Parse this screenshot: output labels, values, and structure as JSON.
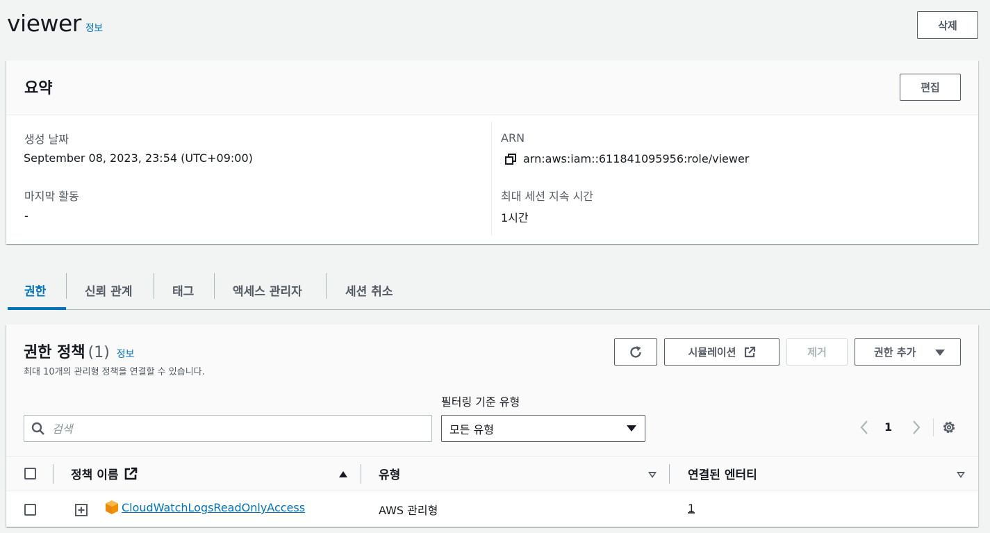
{
  "page": {
    "title": "viewer",
    "info_label": "정보",
    "delete_label": "삭제"
  },
  "summary": {
    "title": "요약",
    "edit_label": "편집",
    "created_label": "생성 날짜",
    "created_value": "September 08, 2023, 23:54 (UTC+09:00)",
    "last_activity_label": "마지막 활동",
    "last_activity_value": "-",
    "arn_label": "ARN",
    "arn_value": "arn:aws:iam::611841095956:role/viewer",
    "max_session_label": "최대 세션 지속 시간",
    "max_session_value": "1시간"
  },
  "tabs": [
    {
      "label": "권한",
      "active": true
    },
    {
      "label": "신뢰 관계"
    },
    {
      "label": "태그"
    },
    {
      "label": "액세스 관리자"
    },
    {
      "label": "세션 취소"
    }
  ],
  "permissions": {
    "title": "권한 정책",
    "count": "(1)",
    "info_label": "정보",
    "description": "최대 10개의 관리형 정책을 연결할 수 있습니다.",
    "simulation_label": "시뮬레이션",
    "remove_label": "제거",
    "add_label": "권한 추가",
    "filter_label": "필터링 기준 유형",
    "search_placeholder": "검색",
    "filter_value": "모든 유형",
    "page_number": "1",
    "columns": {
      "name": "정책 이름",
      "type": "유형",
      "entities": "연결된 엔터티"
    },
    "rows": [
      {
        "name": "CloudWatchLogsReadOnlyAccess",
        "type": "AWS 관리형",
        "entities": "1"
      }
    ]
  },
  "colors": {
    "accent": "#0073bb",
    "text": "#16191f",
    "secondary": "#545b64",
    "background": "#f2f3f3",
    "aws_icon": "#f29100"
  }
}
